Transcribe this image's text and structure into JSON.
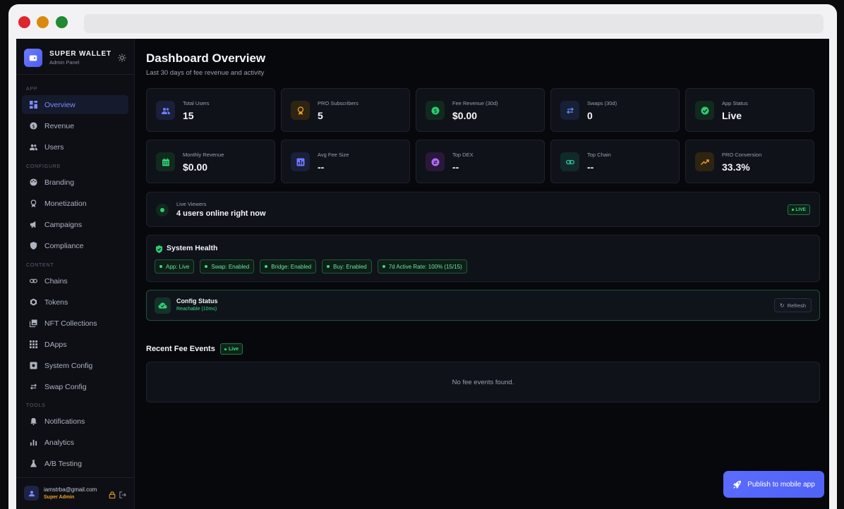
{
  "brand": {
    "title": "SUPER WALLET",
    "subtitle": "Admin Panel"
  },
  "sidebar": {
    "sections": {
      "app": "APP",
      "configure": "CONFIGURE",
      "content": "CONTENT",
      "tools": "TOOLS"
    },
    "items": [
      {
        "label": "Overview",
        "icon": "dashboard-icon",
        "active": true
      },
      {
        "label": "Revenue",
        "icon": "dollar-icon"
      },
      {
        "label": "Users",
        "icon": "users-icon"
      },
      {
        "label": "Branding",
        "icon": "palette-icon"
      },
      {
        "label": "Monetization",
        "icon": "award-icon"
      },
      {
        "label": "Campaigns",
        "icon": "megaphone-icon"
      },
      {
        "label": "Compliance",
        "icon": "shield-icon"
      },
      {
        "label": "Chains",
        "icon": "link-icon"
      },
      {
        "label": "Tokens",
        "icon": "token-icon"
      },
      {
        "label": "NFT Collections",
        "icon": "image-stack-icon"
      },
      {
        "label": "DApps",
        "icon": "grid-icon"
      },
      {
        "label": "System Config",
        "icon": "settings-icon"
      },
      {
        "label": "Swap Config",
        "icon": "swap-icon"
      },
      {
        "label": "Notifications",
        "icon": "bell-icon"
      },
      {
        "label": "Analytics",
        "icon": "bar-chart-icon"
      },
      {
        "label": "A/B Testing",
        "icon": "flask-icon"
      }
    ]
  },
  "user": {
    "email": "iamstrba@gmail.com",
    "role": "Super Admin"
  },
  "header": {
    "title": "Dashboard Overview",
    "subtitle": "Last 30 days of fee revenue and activity"
  },
  "stats": [
    {
      "label": "Total Users",
      "value": "15",
      "icon": "users-icon",
      "color": "#6c7bff"
    },
    {
      "label": "PRO Subscribers",
      "value": "5",
      "icon": "award-icon",
      "color": "#f0a020"
    },
    {
      "label": "Fee Revenue (30d)",
      "value": "$0.00",
      "icon": "dollar-icon",
      "color": "#2ecc71"
    },
    {
      "label": "Swaps (30d)",
      "value": "0",
      "icon": "swap-icon",
      "color": "#5b8cff"
    },
    {
      "label": "App Status",
      "value": "Live",
      "icon": "check-circle-icon",
      "color": "#2ecc71"
    },
    {
      "label": "Monthly Revenue",
      "value": "$0.00",
      "icon": "calendar-icon",
      "color": "#2ecc71"
    },
    {
      "label": "Avg Fee Size",
      "value": "--",
      "icon": "chart-box-icon",
      "color": "#6c7bff"
    },
    {
      "label": "Top DEX",
      "value": "--",
      "icon": "dex-icon",
      "color": "#b36bff"
    },
    {
      "label": "Top Chain",
      "value": "--",
      "icon": "link-icon",
      "color": "#2ec4a8"
    },
    {
      "label": "PRO Conversion",
      "value": "33.3%",
      "icon": "trending-up-icon",
      "color": "#f0a020"
    }
  ],
  "live": {
    "label": "Live Viewers",
    "text": "4 users online right now",
    "badge": "LIVE"
  },
  "health": {
    "title": "System Health",
    "chips": [
      "App: Live",
      "Swap: Enabled",
      "Bridge: Enabled",
      "Buy: Enabled",
      "7d Active Rate: 100% (15/15)"
    ]
  },
  "config": {
    "title": "Config Status",
    "subtitle": "Reachable (10ms)",
    "refresh_label": "Refresh"
  },
  "recent": {
    "title": "Recent Fee Events",
    "badge": "Live",
    "empty_text": "No fee events found."
  },
  "publish": {
    "label": "Publish to mobile app"
  }
}
